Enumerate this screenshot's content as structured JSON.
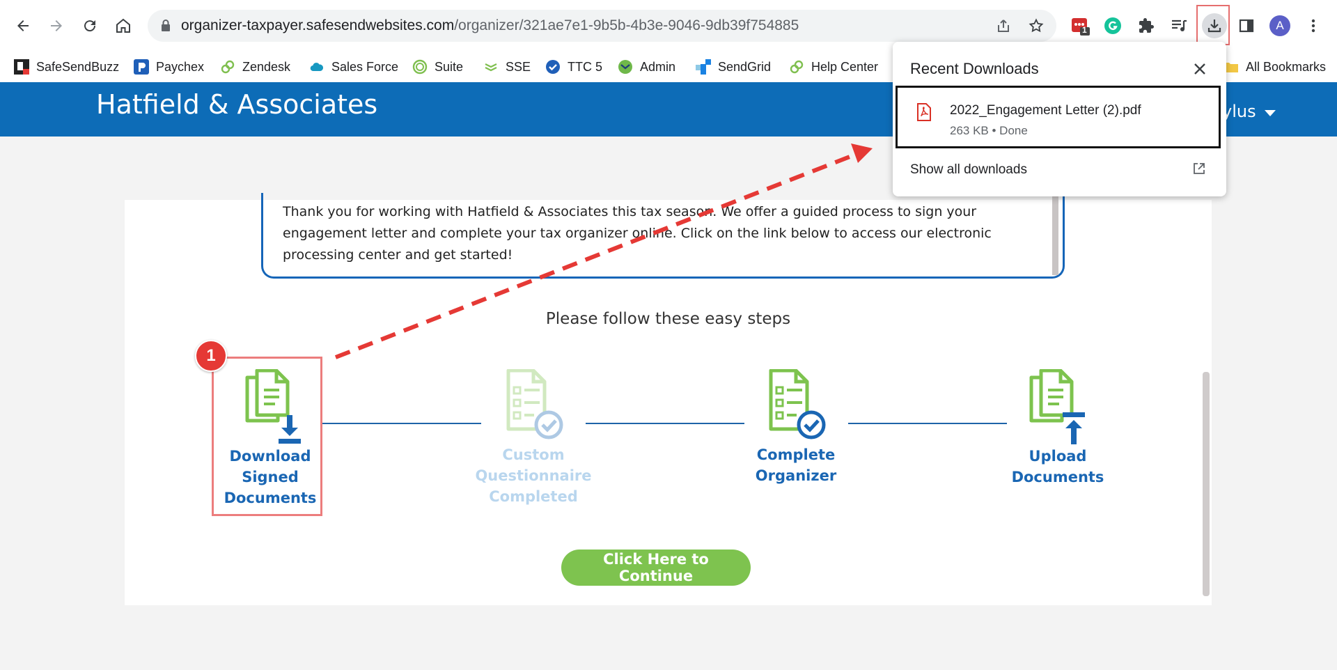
{
  "browser": {
    "url_host": "organizer-taxpayer.safesendwebsites.com",
    "url_path": "/organizer/321ae7e1-9b5b-4b3e-9046-9db39f754885",
    "extension_badge": "1",
    "profile_initial": "A"
  },
  "bookmarks": {
    "items": [
      {
        "label": "SafeSendBuzz",
        "icon": "safesendbuzz-icon"
      },
      {
        "label": "Paychex",
        "icon": "paychex-icon"
      },
      {
        "label": "Zendesk",
        "icon": "zendesk-icon"
      },
      {
        "label": "Sales Force",
        "icon": "salesforce-cloud-icon"
      },
      {
        "label": "Suite",
        "icon": "suite-ring-icon"
      },
      {
        "label": "SSE",
        "icon": "sse-icon"
      },
      {
        "label": "TTC 5",
        "icon": "ttc-check-icon"
      },
      {
        "label": "Admin",
        "icon": "admin-icon"
      },
      {
        "label": "SendGrid",
        "icon": "sendgrid-icon"
      },
      {
        "label": "Help Center",
        "icon": "help-center-icon"
      }
    ],
    "all_bookmarks": "All Bookmarks"
  },
  "header": {
    "firm_name": "Hatfield & Associates",
    "user_name_partial": "ylus"
  },
  "letter": {
    "text": "Thank you for working with Hatfield & Associates  this tax season. We offer a guided process to sign your engagement letter and complete your tax organizer online.  Click on the link below to access our electronic processing center and get started!"
  },
  "steps": {
    "title": "Please follow these easy steps",
    "items": [
      {
        "label": "Download Signed Documents",
        "state": "active"
      },
      {
        "label": "Custom Questionnaire Completed",
        "state": "disabled"
      },
      {
        "label": "Complete Organizer",
        "state": "active"
      },
      {
        "label": "Upload Documents",
        "state": "active"
      }
    ],
    "continue_label": "Click Here to Continue"
  },
  "downloads": {
    "title": "Recent Downloads",
    "file_name": "2022_Engagement Letter (2).pdf",
    "file_meta": "263 KB • Done",
    "show_all": "Show all downloads"
  },
  "annotation": {
    "badge_number": "1"
  },
  "colors": {
    "brand_blue": "#0d6cb7",
    "step_green": "#7dc34e",
    "step_blue": "#1a66b3",
    "continue_green": "#7ec34f",
    "annotation_red": "#e53935"
  }
}
